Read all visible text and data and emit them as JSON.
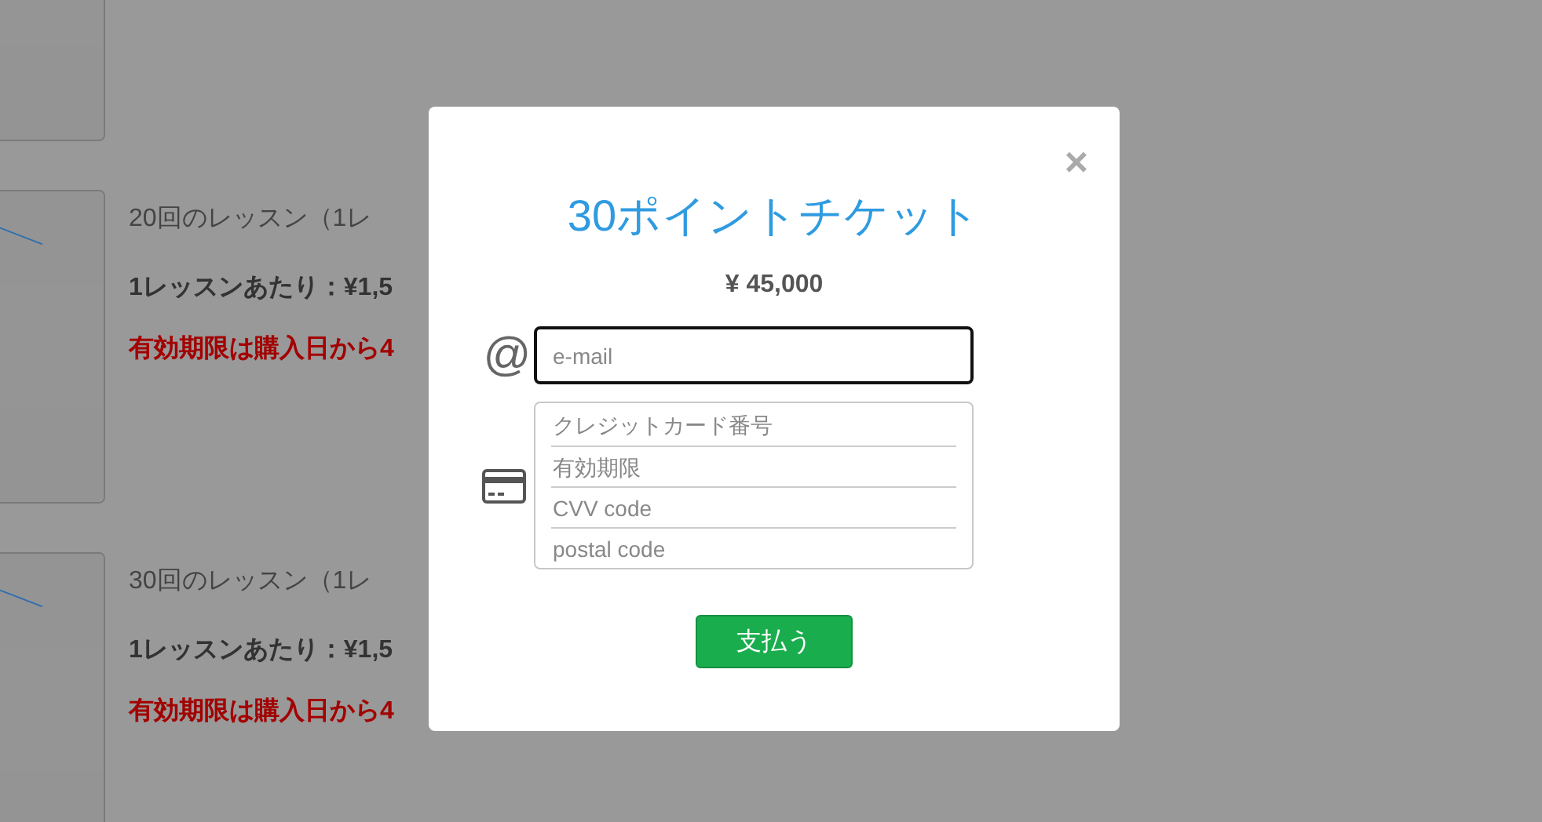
{
  "products": [
    {
      "kind": "picture"
    },
    {
      "kind": "picture",
      "title": "20回のレッスン（1レ",
      "per_lesson": "1レッスンあたり：¥1,5",
      "expiry": "有効期限は購入日から4"
    },
    {
      "kind": "picture",
      "title": "30回のレッスン（1レ",
      "per_lesson": "1レッスンあたり：¥1,5",
      "expiry": "有効期限は購入日から4"
    }
  ],
  "modal": {
    "close": "×",
    "title": "30ポイントチケット",
    "price": "¥ 45,000",
    "email": {
      "icon": "@",
      "placeholder": "e-mail"
    },
    "card_fields": [
      {
        "placeholder": "クレジットカード番号"
      },
      {
        "placeholder": "有効期限"
      },
      {
        "placeholder": "CVV code"
      },
      {
        "placeholder": "postal code"
      }
    ],
    "pay_button": "支払う"
  }
}
